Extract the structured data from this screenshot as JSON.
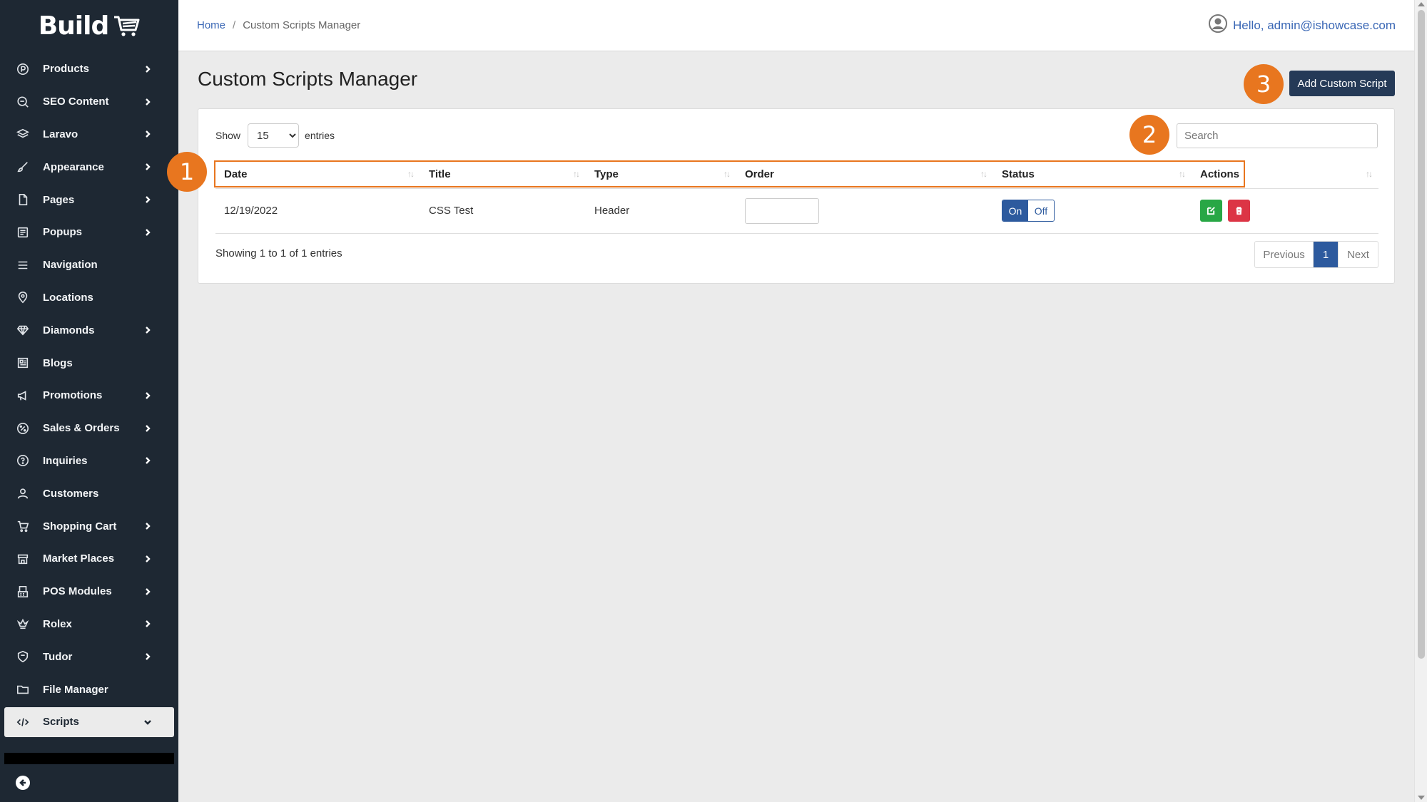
{
  "brand": {
    "name": "Build"
  },
  "sidebar": {
    "items": [
      {
        "label": "Products",
        "icon": "products-icon",
        "has_submenu": true
      },
      {
        "label": "SEO Content",
        "icon": "seo-icon",
        "has_submenu": true
      },
      {
        "label": "Laravo",
        "icon": "layers-icon",
        "has_submenu": true
      },
      {
        "label": "Appearance",
        "icon": "brush-icon",
        "has_submenu": true
      },
      {
        "label": "Pages",
        "icon": "page-icon",
        "has_submenu": true
      },
      {
        "label": "Popups",
        "icon": "popup-icon",
        "has_submenu": true
      },
      {
        "label": "Navigation",
        "icon": "menu-icon",
        "has_submenu": false
      },
      {
        "label": "Locations",
        "icon": "location-pin-icon",
        "has_submenu": false
      },
      {
        "label": "Diamonds",
        "icon": "diamond-icon",
        "has_submenu": true
      },
      {
        "label": "Blogs",
        "icon": "blog-icon",
        "has_submenu": false
      },
      {
        "label": "Promotions",
        "icon": "megaphone-icon",
        "has_submenu": true
      },
      {
        "label": "Sales & Orders",
        "icon": "percent-icon",
        "has_submenu": true
      },
      {
        "label": "Inquiries",
        "icon": "question-icon",
        "has_submenu": true
      },
      {
        "label": "Customers",
        "icon": "user-icon",
        "has_submenu": false
      },
      {
        "label": "Shopping Cart",
        "icon": "cart-icon",
        "has_submenu": true
      },
      {
        "label": "Market Places",
        "icon": "store-icon",
        "has_submenu": true
      },
      {
        "label": "POS Modules",
        "icon": "pos-icon",
        "has_submenu": true
      },
      {
        "label": "Rolex",
        "icon": "crown-icon",
        "has_submenu": true
      },
      {
        "label": "Tudor",
        "icon": "shield-icon",
        "has_submenu": true
      },
      {
        "label": "File Manager",
        "icon": "folder-icon",
        "has_submenu": false
      },
      {
        "label": "Scripts",
        "icon": "code-icon",
        "has_submenu": true,
        "active": true
      }
    ]
  },
  "topbar": {
    "breadcrumb": {
      "home": "Home",
      "separator": "/",
      "current": "Custom Scripts Manager"
    },
    "user_greeting": "Hello, admin@ishowcase.com"
  },
  "main": {
    "title": "Custom Scripts Manager",
    "add_button": "Add Custom Script",
    "length": {
      "show": "Show",
      "value": "15",
      "entries": "entries",
      "options": [
        "15"
      ]
    },
    "search": {
      "placeholder": "Search",
      "value": ""
    },
    "table": {
      "columns": [
        "Date",
        "Title",
        "Type",
        "Order",
        "Status",
        "Actions"
      ],
      "rows": [
        {
          "date": "12/19/2022",
          "title": "CSS Test",
          "type": "Header",
          "order": "",
          "status_on": "On",
          "status_off": "Off"
        }
      ]
    },
    "info": "Showing 1 to 1 of 1 entries",
    "pagination": {
      "previous": "Previous",
      "current": "1",
      "next": "Next"
    }
  },
  "callouts": [
    "1",
    "2",
    "3"
  ],
  "colors": {
    "sidebar_bg": "#1e2833",
    "accent": "#2d5a9e",
    "callout": "#e8761f",
    "edit": "#28a745",
    "delete": "#dc3545",
    "primary_button": "#253a57"
  }
}
